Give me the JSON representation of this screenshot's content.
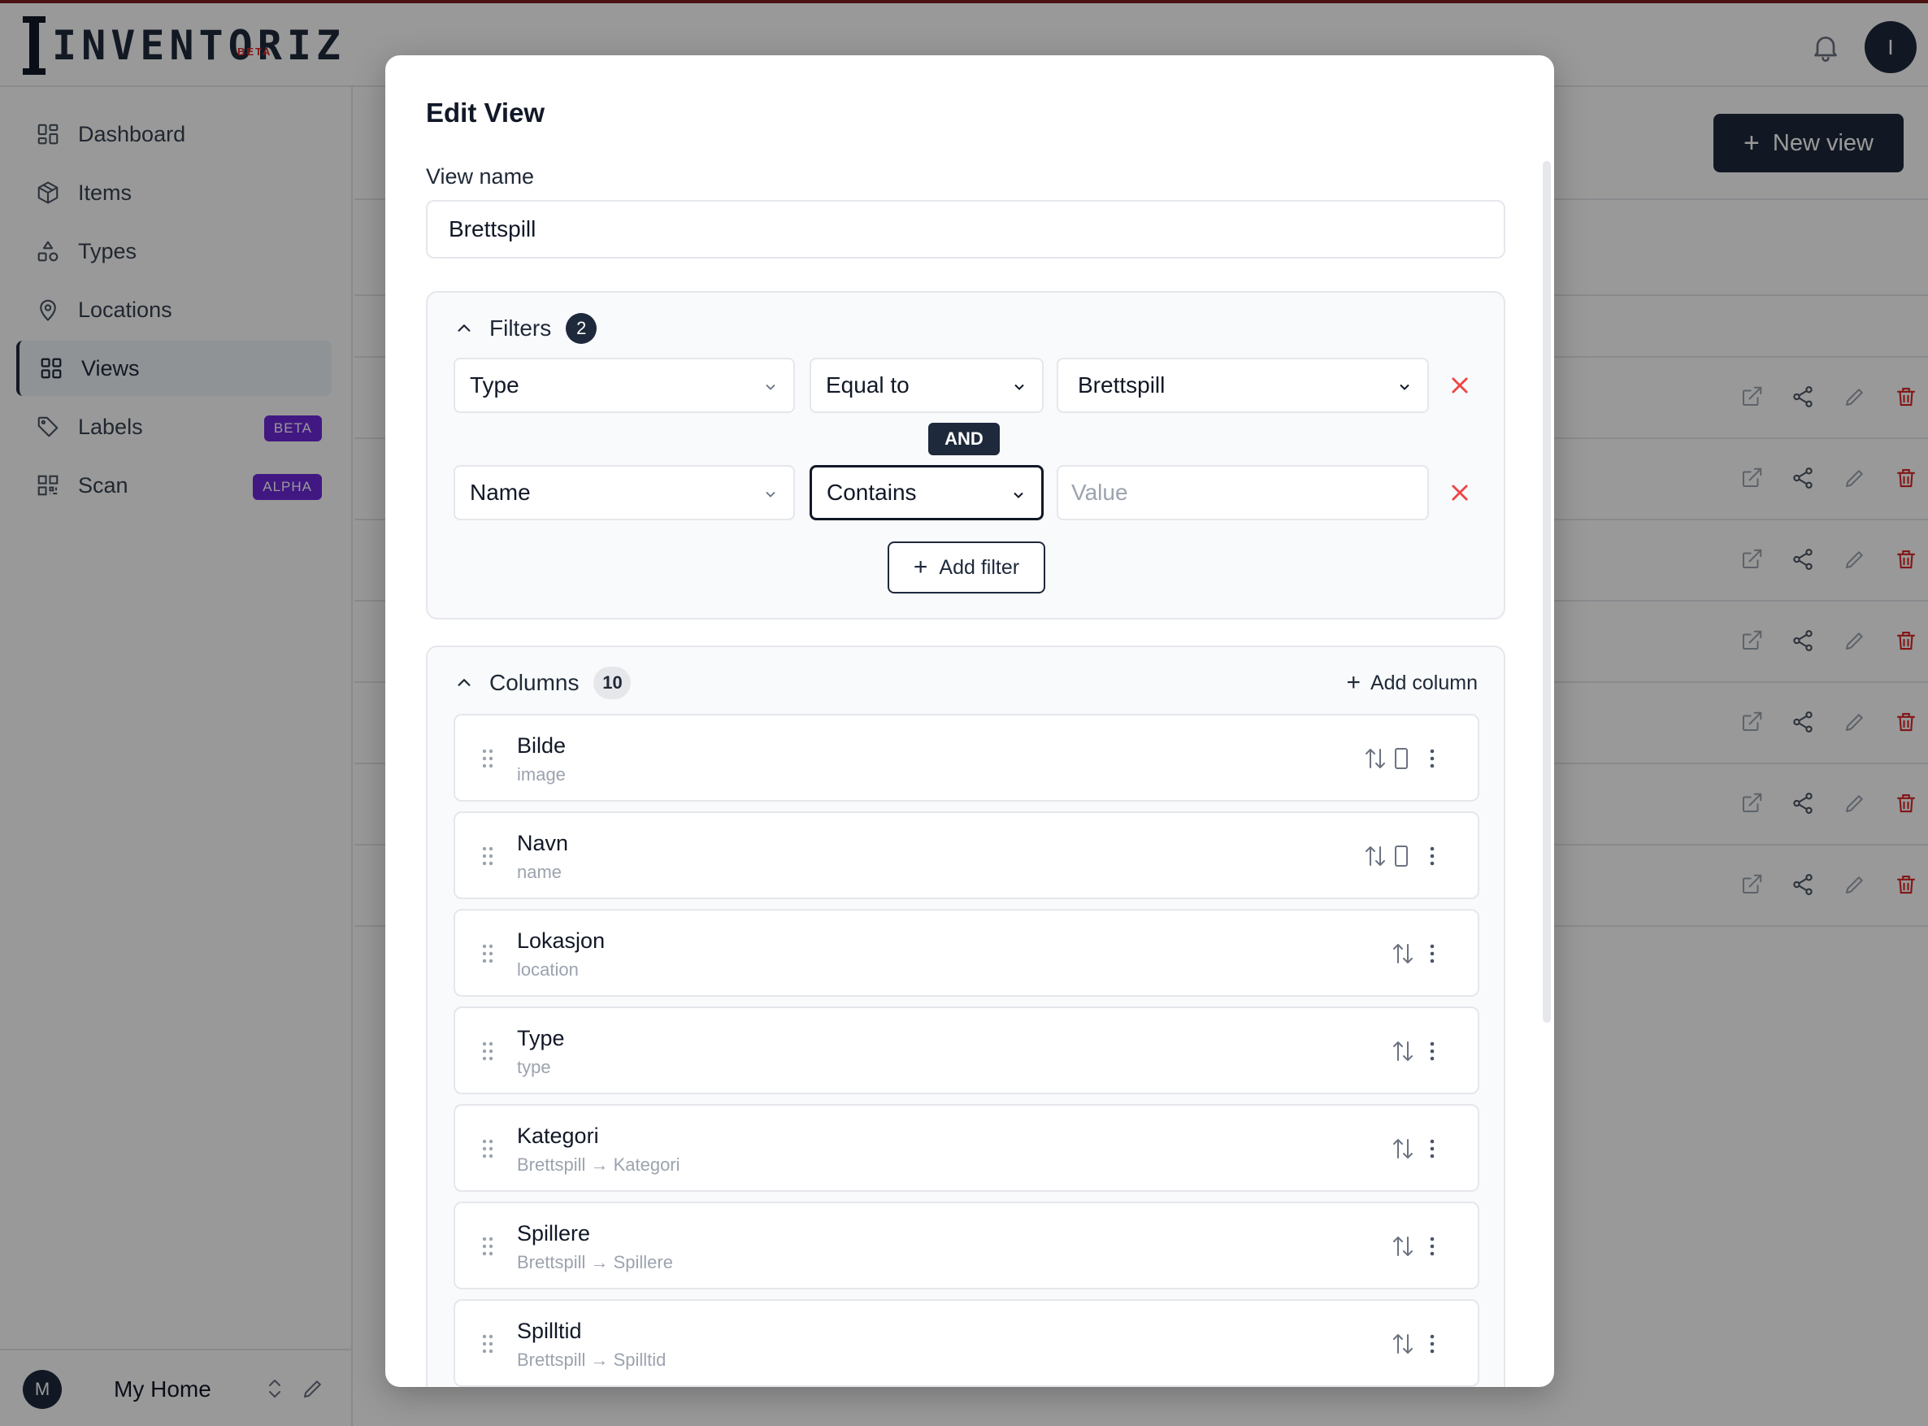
{
  "app": {
    "logo_text": "INVENTORIZ",
    "logo_badge": "BETA",
    "user_initial": "I"
  },
  "sidebar": {
    "items": [
      {
        "label": "Dashboard",
        "icon": "dashboard-grid-icon"
      },
      {
        "label": "Items",
        "icon": "box-icon"
      },
      {
        "label": "Types",
        "icon": "shapes-icon"
      },
      {
        "label": "Locations",
        "icon": "map-pin-icon"
      },
      {
        "label": "Views",
        "icon": "views-grid-icon",
        "active": true
      },
      {
        "label": "Labels",
        "icon": "tag-icon",
        "badge": "BETA",
        "badge_color": "#6d28d9"
      },
      {
        "label": "Scan",
        "icon": "qr-code-icon",
        "badge": "ALPHA",
        "badge_color": "#6d28d9"
      }
    ],
    "footer": {
      "avatar_initial": "M",
      "home_name": "My Home"
    }
  },
  "main": {
    "new_view_label": "New view"
  },
  "modal": {
    "title": "Edit View",
    "view_name_label": "View name",
    "view_name_value": "Brettspill",
    "filters": {
      "title": "Filters",
      "count": "2",
      "rows": [
        {
          "field": "Type",
          "operator": "Equal to",
          "value": "Brettspill",
          "value_placeholder": ""
        },
        {
          "field": "Name",
          "operator": "Contains",
          "value": "",
          "value_placeholder": "Value"
        }
      ],
      "joiner": "AND",
      "add_filter_label": "Add filter"
    },
    "columns": {
      "title": "Columns",
      "count": "10",
      "add_column_label": "Add column",
      "items": [
        {
          "name": "Bilde",
          "key": "image",
          "mobile": true
        },
        {
          "name": "Navn",
          "key": "name",
          "mobile": true
        },
        {
          "name": "Lokasjon",
          "key": "location",
          "mobile": false
        },
        {
          "name": "Type",
          "key": "type",
          "mobile": false
        },
        {
          "name": "Kategori",
          "key": "Brettspill → Kategori",
          "mobile": false
        },
        {
          "name": "Spillere",
          "key": "Brettspill → Spillere",
          "mobile": false
        },
        {
          "name": "Spilltid",
          "key": "Brettspill → Spilltid",
          "mobile": false
        }
      ]
    }
  },
  "colors": {
    "primary": "#1e293b",
    "danger": "#dc2626",
    "badge_purple": "#6d28d9",
    "border": "#e5e7eb"
  }
}
